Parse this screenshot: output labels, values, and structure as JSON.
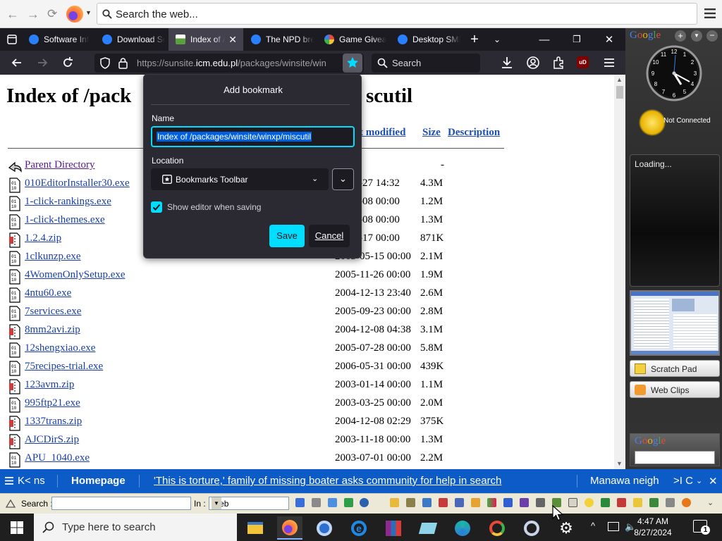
{
  "outer_toolbar": {
    "search_placeholder": "Search the web...",
    "menu_icon": "hamburger-icon"
  },
  "tabs": [
    {
      "label": "Software Inf",
      "favicon": "q-icon",
      "color": "#2a7fff"
    },
    {
      "label": "Download Sc",
      "favicon": "q-icon",
      "color": "#2a7fff"
    },
    {
      "label": "Index of /",
      "favicon": "page-icon",
      "color": "#5aa03c",
      "active": true
    },
    {
      "label": "The NPD bre",
      "favicon": "q-icon",
      "color": "#2a7fff"
    },
    {
      "label": "Game Givea",
      "favicon": "game-icon",
      "color": "#e84a3a"
    },
    {
      "label": "Desktop SMI",
      "favicon": "q-icon",
      "color": "#2a7fff"
    }
  ],
  "navbar": {
    "url_prefix": "https://sunsite.",
    "url_domain": "icm.edu.pl",
    "url_path": "/packages/winsite/win",
    "search_label": "Search"
  },
  "page": {
    "title": "Index of /packages/winsite/winxp/miscutil",
    "title_left": "Index of /pack",
    "title_right": "scutil",
    "columns": {
      "modified": "Last modified",
      "modified_visible": "t modified",
      "size": "Size",
      "description": "Description"
    },
    "parent": {
      "name": "Parent Directory",
      "size": "-"
    },
    "files": [
      {
        "name": "010EditorInstaller30.exe",
        "date": "2008-08-27 14:32",
        "date_visible": "08-27 14:32",
        "size": "4.3M",
        "kind": "exe"
      },
      {
        "name": "1-click-rankings.exe",
        "date": "2004-04-08 00:00",
        "date_visible": "04-08 00:00",
        "size": "1.2M",
        "kind": "exe"
      },
      {
        "name": "1-click-themes.exe",
        "date": "2004-04-08 00:00",
        "date_visible": "04-08 00:00",
        "size": "1.3M",
        "kind": "exe"
      },
      {
        "name": "1.2.4.zip",
        "date": "2003-03-17 00:00",
        "date_visible": "03-17 00:00",
        "size": "871K",
        "kind": "zip"
      },
      {
        "name": "1clkunzp.exe",
        "date": "2003-05-15 00:00",
        "date_visible": "2003-05-15 00:00",
        "size": "2.1M",
        "kind": "exe"
      },
      {
        "name": "4WomenOnlySetup.exe",
        "date": "2005-11-26 00:00",
        "date_visible": "2005-11-26 00:00",
        "size": "1.9M",
        "kind": "exe"
      },
      {
        "name": "4ntu60.exe",
        "date": "2004-12-13 23:40",
        "date_visible": "2004-12-13 23:40",
        "size": "2.6M",
        "kind": "exe"
      },
      {
        "name": "7services.exe",
        "date": "2005-09-23 00:00",
        "date_visible": "2005-09-23 00:00",
        "size": "2.8M",
        "kind": "exe"
      },
      {
        "name": "8mm2avi.zip",
        "date": "2004-12-08 04:38",
        "date_visible": "2004-12-08 04:38",
        "size": "3.1M",
        "kind": "zip"
      },
      {
        "name": "12shengxiao.exe",
        "date": "2005-07-28 00:00",
        "date_visible": "2005-07-28 00:00",
        "size": "5.8M",
        "kind": "exe"
      },
      {
        "name": "75recipes-trial.exe",
        "date": "2006-05-31 00:00",
        "date_visible": "2006-05-31 00:00",
        "size": "439K",
        "kind": "exe"
      },
      {
        "name": "123avm.zip",
        "date": "2003-01-14 00:00",
        "date_visible": "2003-01-14 00:00",
        "size": "1.1M",
        "kind": "zip"
      },
      {
        "name": "995ftp21.exe",
        "date": "2003-03-25 00:00",
        "date_visible": "2003-03-25 00:00",
        "size": "2.0M",
        "kind": "exe"
      },
      {
        "name": "1337trans.zip",
        "date": "2004-12-08 02:29",
        "date_visible": "2004-12-08 02:29",
        "size": "375K",
        "kind": "zip"
      },
      {
        "name": "AJCDirS.zip",
        "date": "2003-11-18 00:00",
        "date_visible": "2003-11-18 00:00",
        "size": "1.3M",
        "kind": "zip"
      },
      {
        "name": "APU_1040.exe",
        "date": "2003-07-01 00:00",
        "date_visible": "2003-07-01 00:00",
        "size": "2.2M",
        "kind": "exe"
      }
    ]
  },
  "bookmark_panel": {
    "title": "Add bookmark",
    "name_label": "Name",
    "name_value": "Index of /packages/winsite/winxp/miscutil",
    "location_label": "Location",
    "location_value": "Bookmarks Toolbar",
    "checkbox_label": "Show editor when saving",
    "checkbox_checked": true,
    "save_label": "Save",
    "cancel_label": "Cancel",
    "accent": "#00ddff"
  },
  "sidebar": {
    "logo": "Google",
    "weather_status": "Not Connected",
    "loading": "Loading...",
    "scratch_pad": "Scratch Pad",
    "web_clips": "Web Clips",
    "search_logo": "Google"
  },
  "ticker": {
    "prev": "K< ns",
    "homepage": "Homepage",
    "headline": "'This is torture,' family of missing boater asks community for help in search",
    "next_headline": "Manawa neigh",
    "controls": ">I C"
  },
  "search_toolbar": {
    "search_label": "Search :",
    "in_label": "In :",
    "in_value": "Web"
  },
  "taskbar": {
    "search_placeholder": "Type here to search",
    "time": "4:47 AM",
    "date": "8/27/2024"
  }
}
